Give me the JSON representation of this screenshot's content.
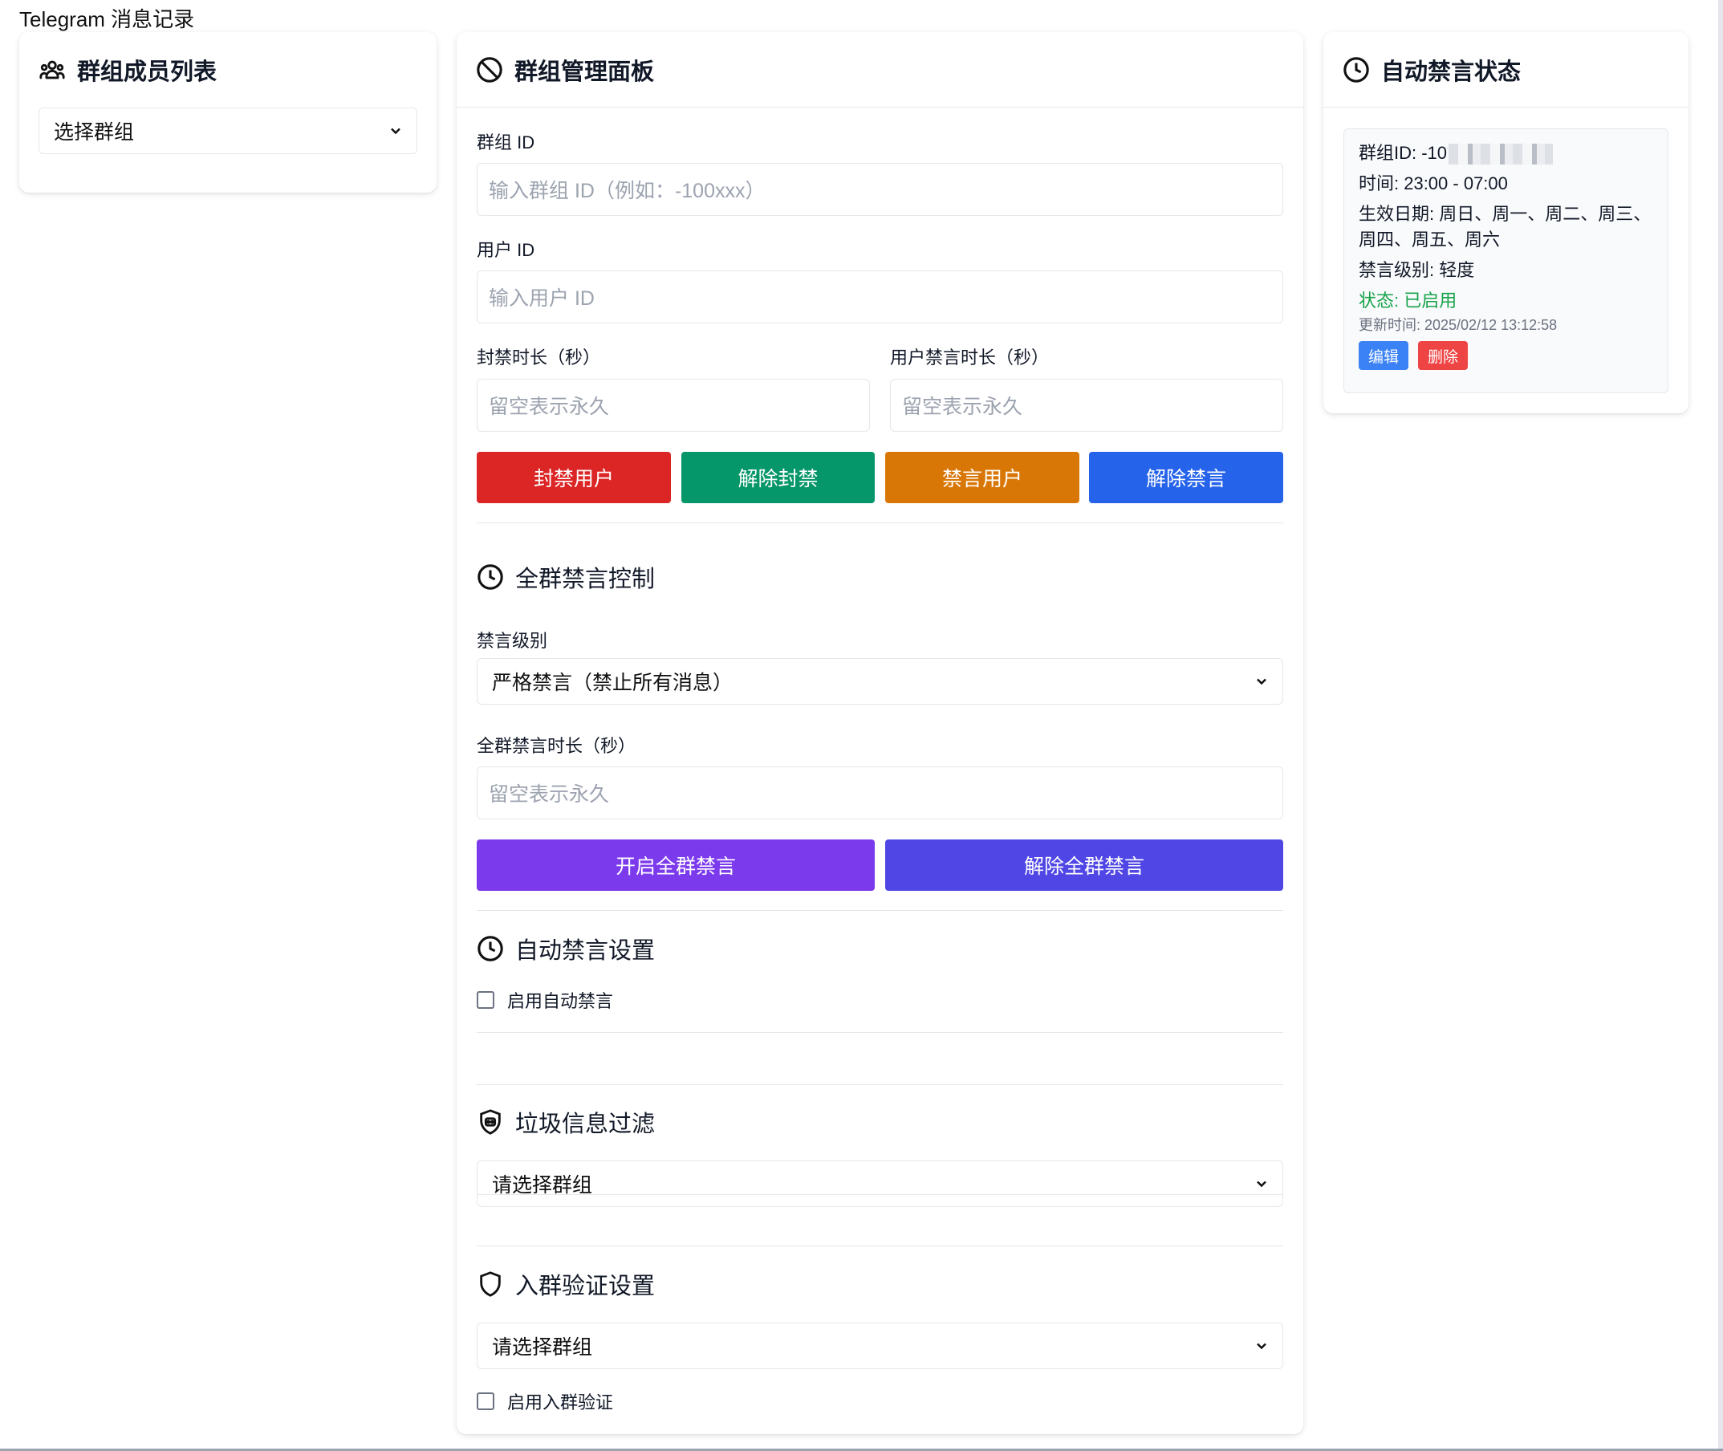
{
  "app": {
    "title": "Telegram 消息记录"
  },
  "members_card": {
    "title": "群组成员列表",
    "group_select": "选择群组"
  },
  "admin_card": {
    "title": "群组管理面板",
    "group_id_label": "群组 ID",
    "group_id_placeholder": "输入群组 ID（例如：-100xxx）",
    "user_id_label": "用户 ID",
    "user_id_placeholder": "输入用户 ID",
    "ban_duration_label": "封禁时长（秒）",
    "ban_duration_placeholder": "留空表示永久",
    "mute_duration_label": "用户禁言时长（秒）",
    "mute_duration_placeholder": "留空表示永久",
    "buttons": {
      "ban": "封禁用户",
      "unban": "解除封禁",
      "mute": "禁言用户",
      "unmute": "解除禁言"
    },
    "global_mute": {
      "title": "全群禁言控制",
      "level_label": "禁言级别",
      "level_value": "严格禁言（禁止所有消息）",
      "duration_label": "全群禁言时长（秒）",
      "duration_placeholder": "留空表示永久",
      "enable_button": "开启全群禁言",
      "disable_button": "解除全群禁言"
    },
    "auto_mute": {
      "title": "自动禁言设置",
      "checkbox_label": "启用自动禁言"
    },
    "spam_filter": {
      "title": "垃圾信息过滤",
      "group_select": "请选择群组"
    },
    "join_verify": {
      "title": "入群验证设置",
      "group_select": "请选择群组",
      "checkbox_label": "启用入群验证"
    }
  },
  "auto_status_card": {
    "title": "自动禁言状态",
    "group_id": "群组ID: -10",
    "time": "时间: 23:00 - 07:00",
    "effective_days": "生效日期: 周日、周一、周二、周三、周四、周五、周六",
    "level": "禁言级别: 轻度",
    "status": "状态: 已启用",
    "updated": "更新时间: 2025/02/12 13:12:58",
    "edit_button": "编辑",
    "delete_button": "删除"
  },
  "colors": {
    "ban": "#dc2626",
    "unban": "#059669",
    "mute": "#d97706",
    "unmute": "#2563eb",
    "global_enable": "#7c3aed",
    "global_disable": "#4f46e5",
    "edit": "#3b82f6",
    "delete": "#ef4444",
    "status_green": "#16a34a"
  },
  "icons": {
    "members": "users-icon",
    "admin": "ban-icon",
    "clock": "clock-icon",
    "spam": "shield-robot-icon",
    "verify": "shield-icon",
    "chevron": "chevron-down-icon"
  }
}
